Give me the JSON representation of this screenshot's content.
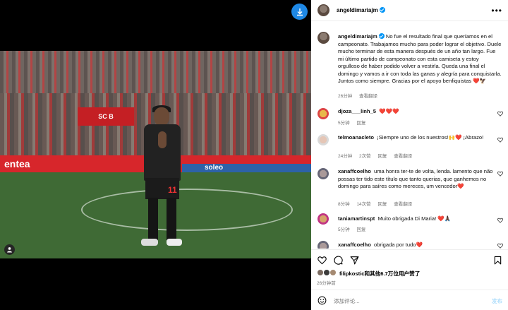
{
  "post": {
    "username": "angeldimariajm",
    "caption": "No fue el resultado final que queríamos en el campeonato. Trabajamos mucho para poder lograr el objetivo. Duele mucho terminar de esta manera después de un año tan largo. Fue mi último partido de campeonato con esta camiseta y estoy orgulloso de haber podido volver a vestirla. Queda una final el domingo y vamos a ir con toda las ganas y alegría para conquistarla. Juntos como siempre. Gracias por el apoyo benfiquistas",
    "caption_emoji": "❤️🦅",
    "caption_time": "26分钟",
    "caption_translate": "查看翻译",
    "scoreboard_text": "SC B",
    "adboard_left": "entea",
    "adboard_right": "soleo"
  },
  "comments": [
    {
      "username": "djoza___linh_5",
      "text": "❤️❤️❤️",
      "time": "5分钟",
      "reply": "回复",
      "likes": "",
      "translate": ""
    },
    {
      "username": "telmoanacleto",
      "text": "¡Siempre uno de los nuestros!🙌❤️ ¡Abrazo!",
      "time": "24分钟",
      "likes": "2次赞",
      "reply": "回复",
      "translate": "查看翻译"
    },
    {
      "username": "xanaffcoelho",
      "text": "uma honra ter-te de volta, lenda. lamento que não possas ter tido este título que tanto querias, que ganhemos no domingo para saíres como mereces, um vencedor❤️",
      "time": "8分钟",
      "likes": "14次赞",
      "reply": "回复",
      "translate": "查看翻译"
    },
    {
      "username": "taniamartinspt",
      "text": "Muito obrigada Di Maria! ❤️🙏🏿",
      "time": "5分钟",
      "reply": "回复",
      "likes": "",
      "translate": ""
    },
    {
      "username": "xanaffcoelho",
      "text": "obrigada por tudo❤️",
      "time": "",
      "reply": "",
      "likes": "",
      "translate": ""
    }
  ],
  "likes": {
    "text": "filipkostic和其他6.7万位用户赞了",
    "time": "26分钟前"
  },
  "add_comment": {
    "placeholder": "添加评论...",
    "post_label": "发布"
  },
  "icons": {
    "download": "download-icon",
    "tag": "person-tag-icon",
    "more": "more-horizontal-icon",
    "like": "heart-icon",
    "comment": "comment-icon",
    "share": "share-icon",
    "save": "bookmark-icon",
    "emoji": "emoji-icon"
  },
  "colors": {
    "verified": "#0095f6",
    "heart": "#ed4956",
    "accent_blue": "#1e88e5",
    "benfica_red": "#c41f24"
  }
}
